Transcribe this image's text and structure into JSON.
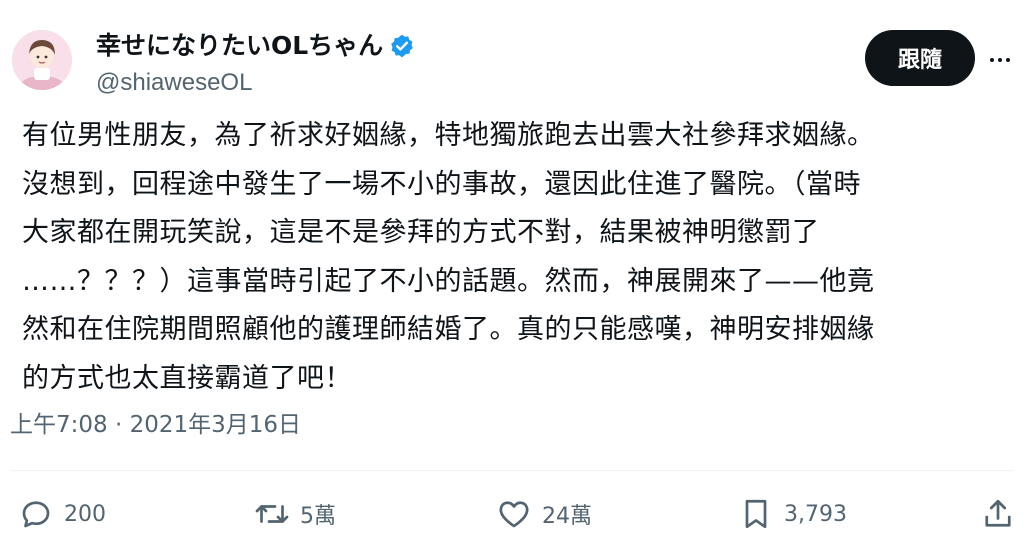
{
  "author": {
    "display_name": "幸せになりたいOLちゃん",
    "handle": "@shiaweseOL",
    "verified_color": "#1d9bf0"
  },
  "follow_button": {
    "label": "跟隨"
  },
  "tweet": {
    "lines": [
      "有位男性朋友，為了祈求好姻緣，特地獨旅跑去出雲大社參拜求姻緣。",
      "沒想到，回程途中發生了一場不小的事故，還因此住進了醫院。（當時",
      "大家都在開玩笑說，這是不是參拜的方式不對，結果被神明懲罰了",
      "……？？？）這事當時引起了不小的話題。然而，神展開來了——他竟",
      "然和在住院期間照顧他的護理師結婚了。真的只能感嘆，神明安排姻緣",
      "的方式也太直接霸道了吧！"
    ],
    "timestamp": "上午7:08 · 2021年3月16日"
  },
  "actions": {
    "reply_count": "200",
    "retweet_count": "5萬",
    "like_count": "24萬",
    "bookmark_count": "3,793"
  },
  "icons": {
    "reply": "reply-icon",
    "retweet": "retweet-icon",
    "like": "heart-icon",
    "bookmark": "bookmark-icon",
    "share": "share-icon",
    "more": "more-icon"
  }
}
